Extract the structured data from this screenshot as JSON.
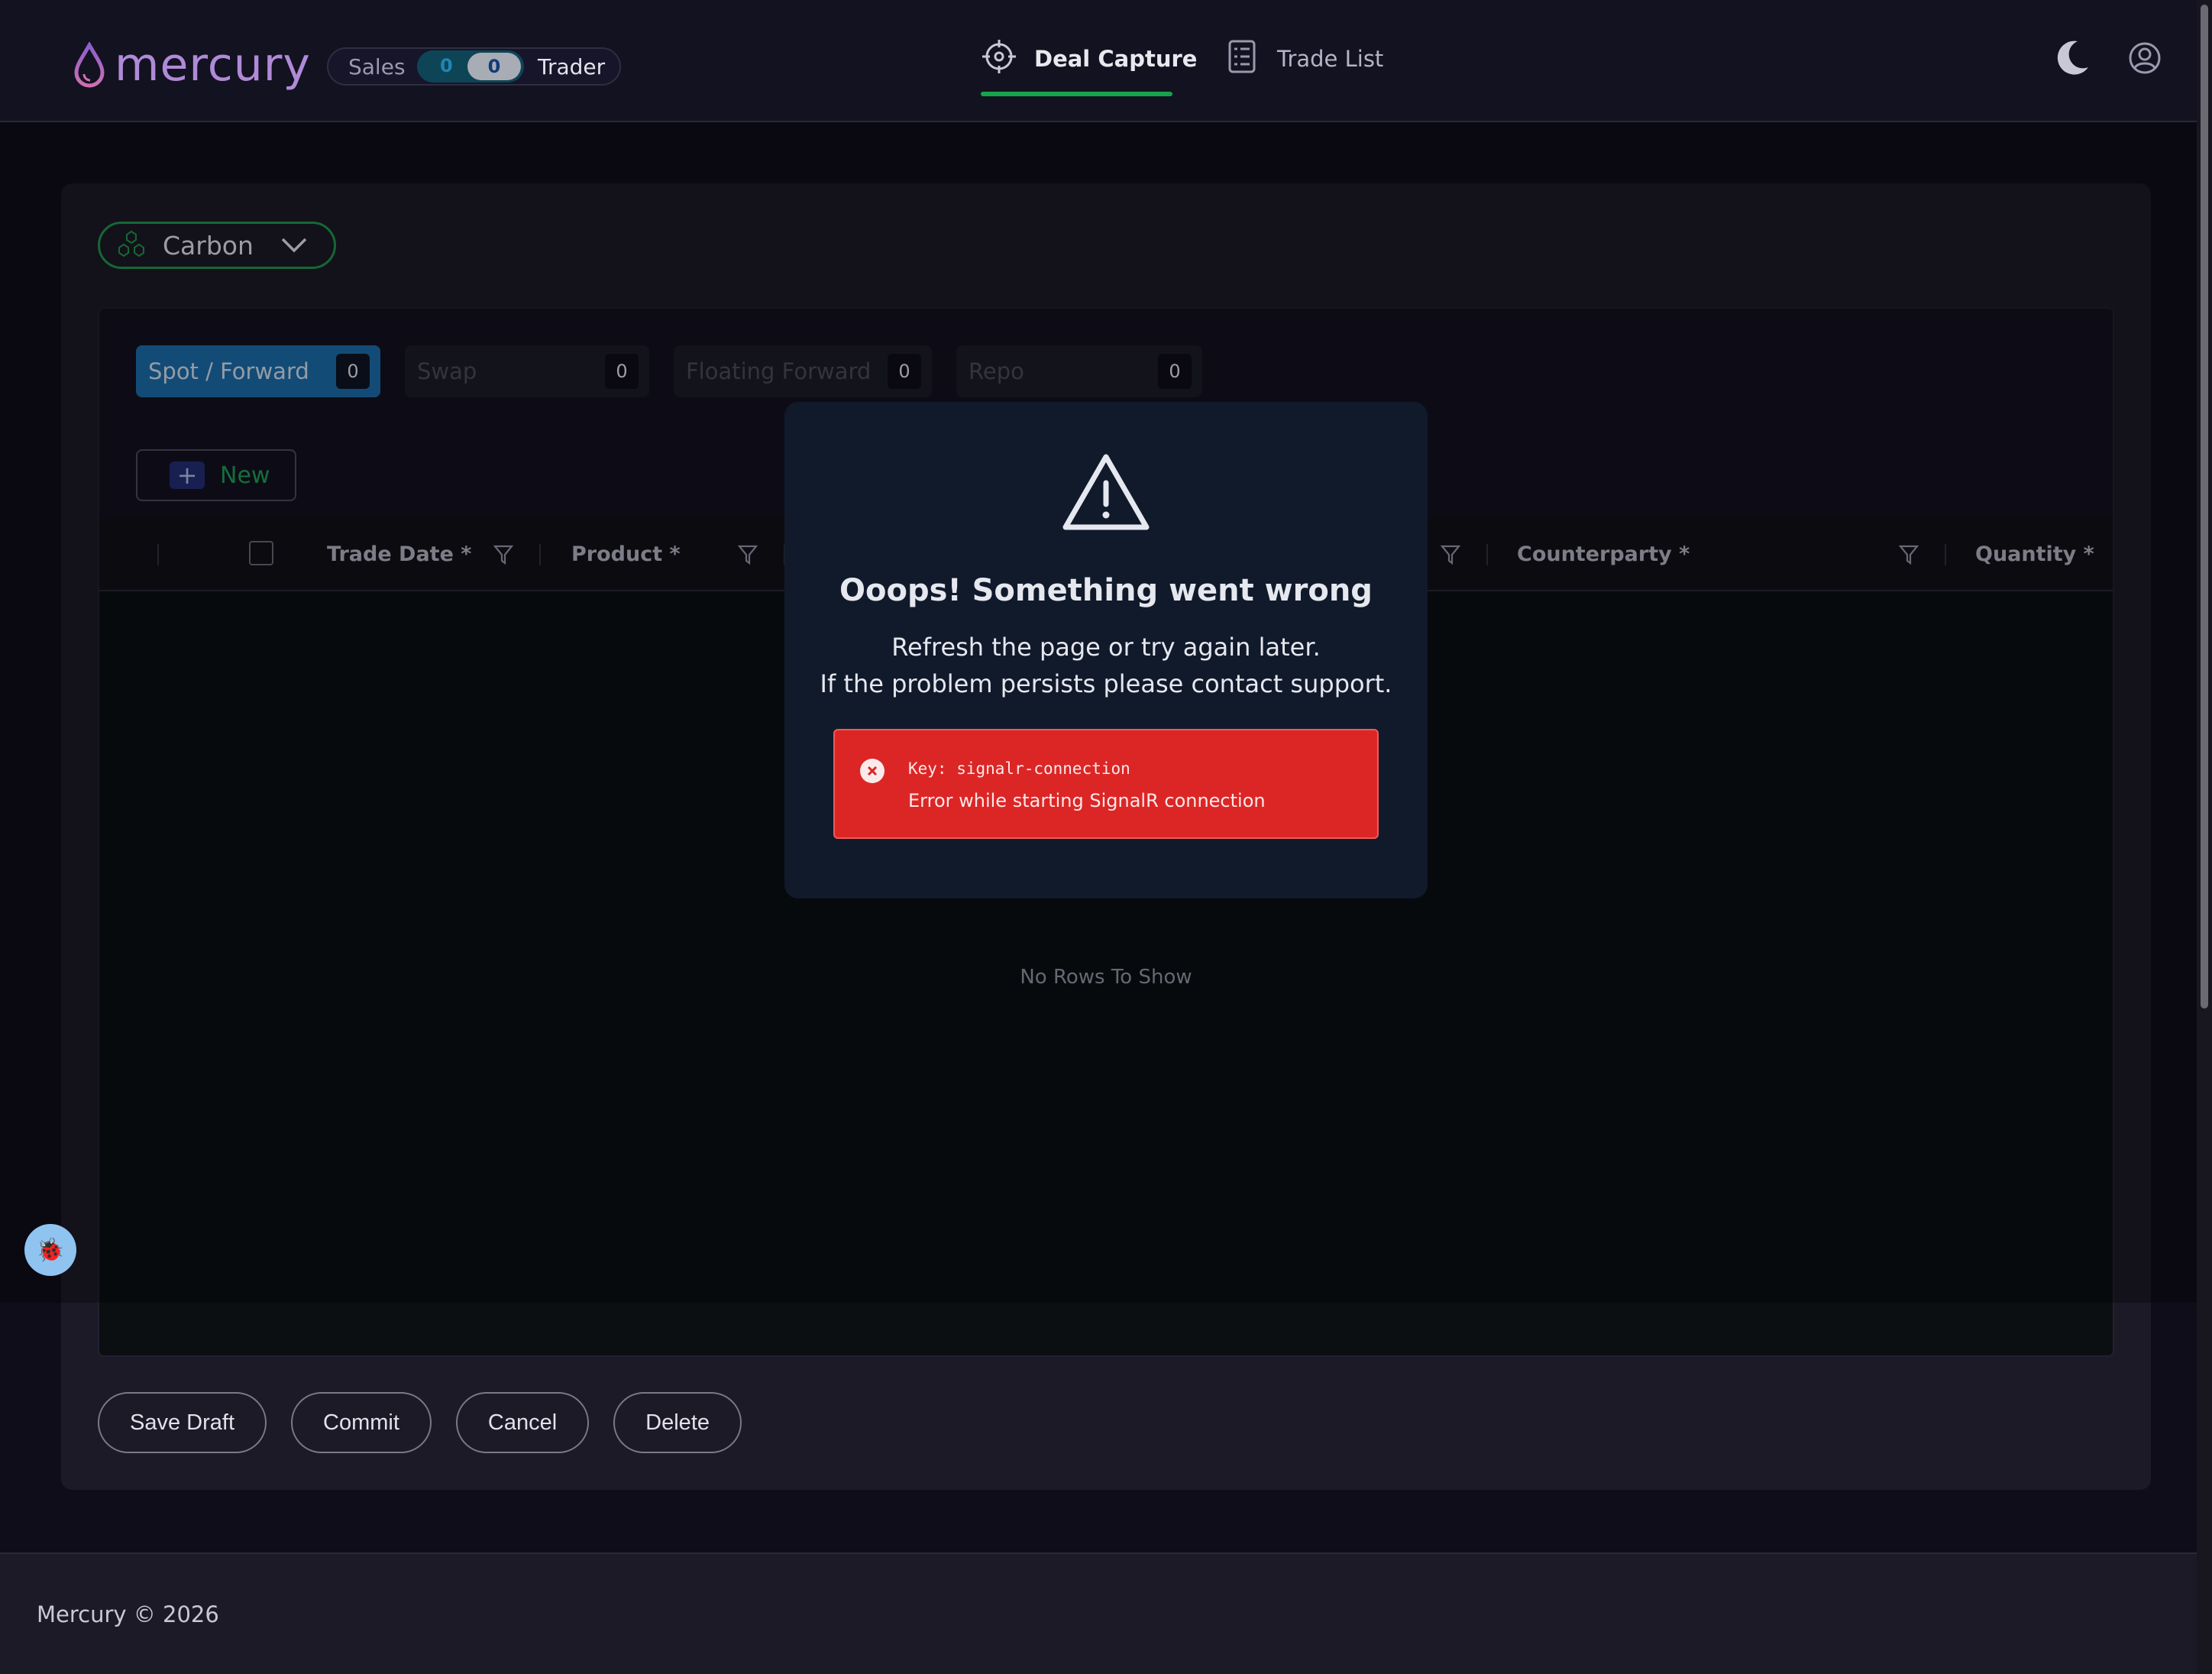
{
  "app": {
    "name": "mercury"
  },
  "role_toggle": {
    "left_label": "Sales",
    "left_count": "0",
    "right_count": "0",
    "right_label": "Trader"
  },
  "nav": {
    "deal_capture": "Deal Capture",
    "trade_list": "Trade List"
  },
  "commodity": {
    "selected": "Carbon"
  },
  "trade_tabs": [
    {
      "label": "Spot / Forward",
      "count": "0",
      "active": true
    },
    {
      "label": "Swap",
      "count": "0"
    },
    {
      "label": "Floating Forward",
      "count": "0"
    },
    {
      "label": "Repo",
      "count": "0"
    }
  ],
  "new_button": "New",
  "columns": [
    "Trade Date *",
    "Product *",
    "Counterparty *",
    "Quantity *"
  ],
  "grid": {
    "empty_text": "No Rows To Show"
  },
  "actions": {
    "save_draft": "Save Draft",
    "commit": "Commit",
    "cancel": "Cancel",
    "delete": "Delete"
  },
  "modal": {
    "title": "Ooops! Something went wrong",
    "line1": "Refresh the page or try again later.",
    "line2": "If the problem persists please contact support.",
    "error_key": "Key: signalr-connection",
    "error_message": "Error while starting SignalR connection"
  },
  "footer": {
    "text": "Mercury © 2026"
  },
  "colors": {
    "accent_green": "#16a34a",
    "active_tab": "#1d6fb0",
    "error_red": "#dc2626",
    "logo": "#b08ad8"
  },
  "icons": [
    "droplet-logo-icon",
    "crosshair-icon",
    "list-icon",
    "moon-icon",
    "user-circle-icon",
    "hexagon-network-icon",
    "chevron-down-icon",
    "plus-icon",
    "filter-icon",
    "warning-triangle-icon",
    "x-circle-icon",
    "bug-icon"
  ]
}
